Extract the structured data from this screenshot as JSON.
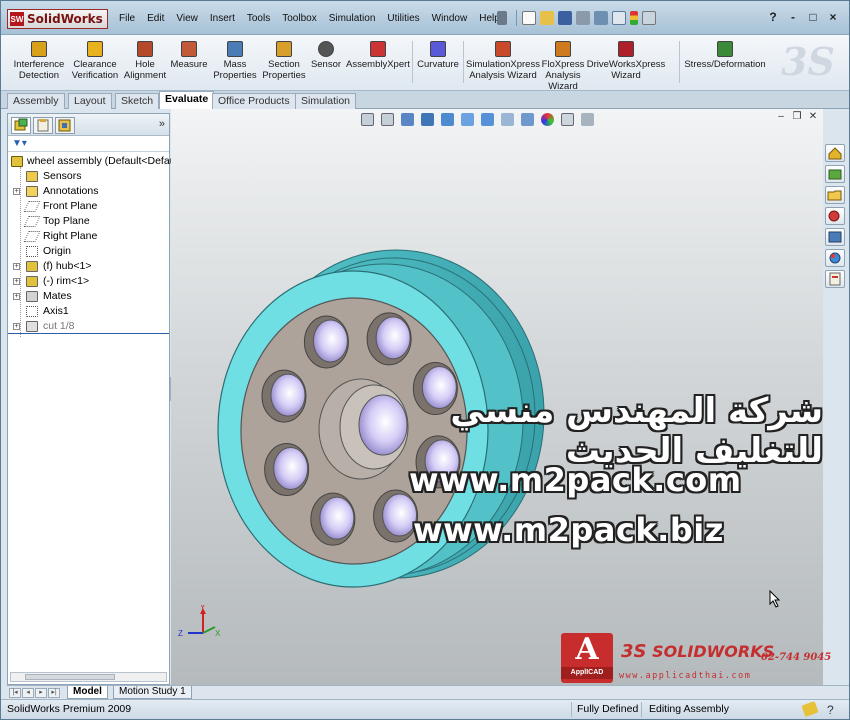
{
  "app": {
    "logo_text": "SolidWorks",
    "logo_mark": "SW"
  },
  "menu": [
    "File",
    "Edit",
    "View",
    "Insert",
    "Tools",
    "Toolbox",
    "Simulation",
    "Utilities",
    "Window",
    "Help"
  ],
  "window_controls": [
    "?",
    "-",
    "□",
    "×"
  ],
  "command_manager": [
    {
      "label": "Interference\nDetection",
      "icon": "interference-detection-icon",
      "color": "#d9a11b"
    },
    {
      "label": "Clearance\nVerification",
      "icon": "clearance-verification-icon",
      "color": "#e8b21c"
    },
    {
      "label": "Hole\nAlignment",
      "icon": "hole-alignment-icon",
      "color": "#b44a2a"
    },
    {
      "label": "Measure",
      "icon": "measure-icon",
      "color": "#c25a3a"
    },
    {
      "label": "Mass\nProperties",
      "icon": "mass-properties-icon",
      "color": "#4a7cb5"
    },
    {
      "label": "Section\nProperties",
      "icon": "section-properties-icon",
      "color": "#d8a02a"
    },
    {
      "label": "Sensor",
      "icon": "sensor-icon",
      "color": "#555555"
    },
    {
      "label": "AssemblyXpert",
      "icon": "assemblyxpert-icon",
      "color": "#cc3333"
    },
    {
      "label": "Curvature",
      "icon": "curvature-icon",
      "color": "#5a5ad8"
    },
    {
      "label": "SimulationXpress\nAnalysis Wizard",
      "icon": "simulationxpress-icon",
      "color": "#c94a2a"
    },
    {
      "label": "FloXpress\nAnalysis\nWizard",
      "icon": "floxpress-icon",
      "color": "#d07a20"
    },
    {
      "label": "DriveWorksXpress\nWizard",
      "icon": "driveworksxpress-icon",
      "color": "#b0202a"
    },
    {
      "label": "Stress/Deformation",
      "icon": "stress-deformation-icon",
      "color": "#3a8a3a"
    }
  ],
  "tabs": [
    "Assembly",
    "Layout",
    "Sketch",
    "Evaluate",
    "Office Products",
    "Simulation"
  ],
  "active_tab": "Evaluate",
  "tree": {
    "root": "wheel assembly  (Default<Default",
    "items": [
      {
        "label": "Sensors",
        "icon": "sensor-folder-icon",
        "expand": false
      },
      {
        "label": "Annotations",
        "icon": "annotations-icon",
        "expand": true
      },
      {
        "label": "Front Plane",
        "icon": "plane-icon",
        "expand": false
      },
      {
        "label": "Top Plane",
        "icon": "plane-icon",
        "expand": false
      },
      {
        "label": "Right Plane",
        "icon": "plane-icon",
        "expand": false
      },
      {
        "label": "Origin",
        "icon": "origin-icon",
        "expand": false
      },
      {
        "label": "(f) hub<1>",
        "icon": "part-icon",
        "expand": true
      },
      {
        "label": "(-) rim<1>",
        "icon": "part-icon",
        "expand": true
      },
      {
        "label": "Mates",
        "icon": "mates-icon",
        "expand": true
      },
      {
        "label": "Axis1",
        "icon": "axis-icon",
        "expand": false
      },
      {
        "label": "cut 1/8",
        "icon": "cut-icon",
        "expand": true,
        "dim": true
      }
    ]
  },
  "watermark": {
    "arabic": "شركة المهندس منسي للتغليف الحديث",
    "url1": "www.m2pack.com",
    "url2": "www.m2pack.biz"
  },
  "branding": {
    "applicad": "ApplICAD",
    "ds_mark": "3S",
    "solidworks": "SOLIDWORKS",
    "phone": "02-744 9045",
    "website": "www.applicadthai.com"
  },
  "bottom_tabs": [
    "Model",
    "Motion Study 1"
  ],
  "active_bottom_tab": "Model",
  "status": {
    "product": "SolidWorks Premium 2009",
    "state": "Fully Defined",
    "mode": "Editing Assembly"
  },
  "colors": {
    "rim": "#6fdfe3",
    "hub": "#ada39b",
    "hole": "#c7bff0"
  }
}
